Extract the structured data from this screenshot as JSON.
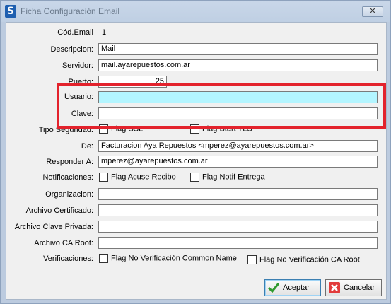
{
  "window": {
    "title": "Ficha Configuración Email",
    "close": "✕"
  },
  "labels": {
    "cod_email": "Cód.Email",
    "descripcion": "Descripcion:",
    "servidor": "Servidor:",
    "puerto": "Puerto:",
    "usuario": "Usuario:",
    "clave": "Clave:",
    "tipo_seguridad": "Tipo Seguridad:",
    "de": "De:",
    "responder_a": "Responder A:",
    "notificaciones": "Notificaciones:",
    "organizacion": "Organizacion:",
    "archivo_certificado": "Archivo Certificado:",
    "archivo_clave_privada": "Archivo Clave Privada:",
    "archivo_ca_root": "Archivo CA Root:",
    "verificaciones": "Verificaciones:"
  },
  "values": {
    "cod_email": "1",
    "descripcion": "Mail",
    "servidor": "mail.ayarepuestos.com.ar",
    "puerto": "25",
    "usuario": "",
    "clave": "",
    "de": "Facturacion Aya Repuestos <mperez@ayarepuestos.com.ar>",
    "responder_a": "mperez@ayarepuestos.com.ar",
    "organizacion": "",
    "archivo_certificado": "",
    "archivo_clave_privada": "",
    "archivo_ca_root": ""
  },
  "checkboxes": {
    "flag_ssl": "Flag SSL",
    "flag_start_tls": "Flag Start TLS",
    "flag_acuse_recibo": "Flag Acuse Recibo",
    "flag_notif_entrega": "Flag Notif Entrega",
    "flag_no_verif_cn": "Flag No Verificación  Common Name",
    "flag_no_verif_ca": "Flag No Verificación CA Root"
  },
  "buttons": {
    "aceptar_u": "A",
    "aceptar_rest": "ceptar",
    "cancelar_u": "C",
    "cancelar_rest": "ancelar"
  },
  "colors": {
    "highlight": "#e3222c",
    "active_field": "#b3f5ff"
  }
}
